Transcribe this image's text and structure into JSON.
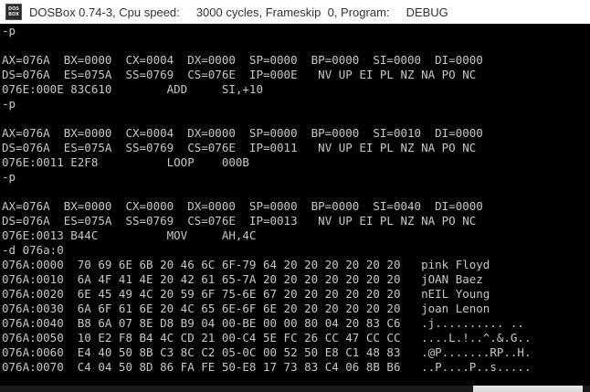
{
  "window": {
    "title": "DOSBox 0.74-3, Cpu speed:     3000 cycles, Frameskip  0, Program:     DEBUG",
    "icon": "dosbox-icon",
    "icon_label": "DOS BOX"
  },
  "console": {
    "lines": [
      "-p",
      "",
      "AX=076A  BX=0000  CX=0004  DX=0000  SP=0000  BP=0000  SI=0000  DI=0000",
      "DS=076A  ES=075A  SS=0769  CS=076E  IP=000E   NV UP EI PL NZ NA PO NC",
      "076E:000E 83C610        ADD     SI,+10",
      "-p",
      "",
      "AX=076A  BX=0000  CX=0004  DX=0000  SP=0000  BP=0000  SI=0010  DI=0000",
      "DS=076A  ES=075A  SS=0769  CS=076E  IP=0011   NV UP EI PL NZ NA PO NC",
      "076E:0011 E2F8          LOOP    000B",
      "-p",
      "",
      "AX=076A  BX=0000  CX=0000  DX=0000  SP=0000  BP=0000  SI=0040  DI=0000",
      "DS=076A  ES=075A  SS=0769  CS=076E  IP=0013   NV UP EI PL NZ NA PO NC",
      "076E:0013 B44C          MOV     AH,4C",
      "-d 076a:0",
      "076A:0000  70 69 6E 6B 20 46 6C 6F-79 64 20 20 20 20 20 20   pink Floyd",
      "076A:0010  6A 4F 41 4E 20 42 61 65-7A 20 20 20 20 20 20 20   jOAN Baez",
      "076A:0020  6E 45 49 4C 20 59 6F 75-6E 67 20 20 20 20 20 20   nEIL Young",
      "076A:0030  6A 6F 61 6E 20 4C 65 6E-6F 6E 20 20 20 20 20 20   joan Lenon",
      "076A:0040  B8 6A 07 8E D8 B9 04 00-BE 00 00 80 04 20 83 C6   .j.......... ..",
      "076A:0050  10 E2 F8 B4 4C CD 21 00-C4 5E FC 26 CC 47 CC CC   ....L.!..^.&.G..",
      "076A:0060  E4 40 50 8B C3 8C C2 05-0C 00 52 50 E8 C1 48 83   .@P.......RP..H.",
      "076A:0070  C4 04 50 8D 86 FA FE 50-E8 17 73 83 C4 06 8B B6   ..P....P..s....."
    ]
  }
}
